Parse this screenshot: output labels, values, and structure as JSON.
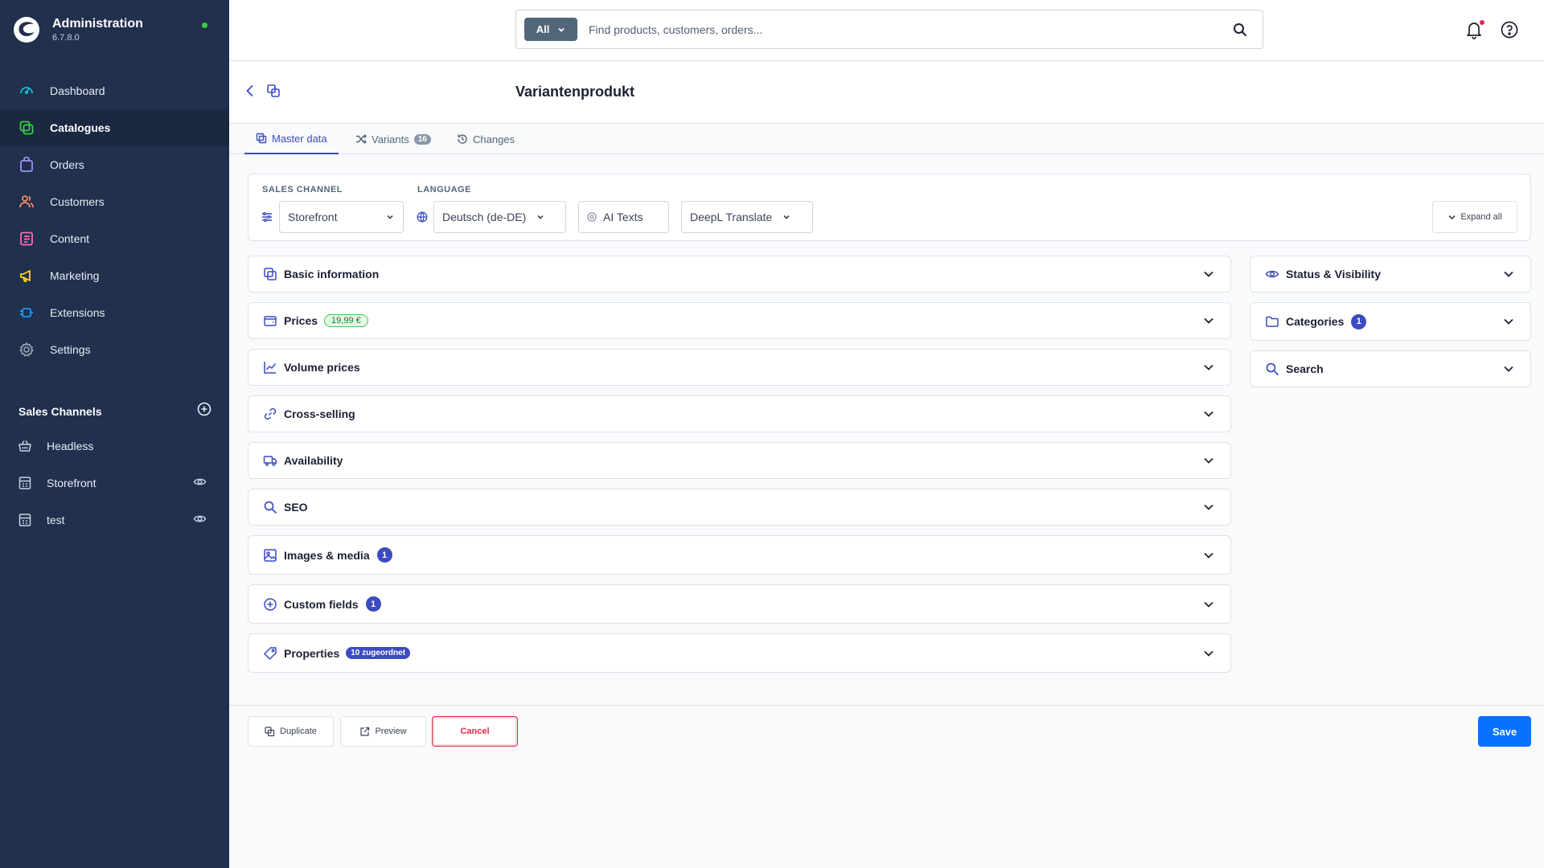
{
  "app": {
    "title": "Administration",
    "version": "6.7.8.0",
    "status_color": "#37d046"
  },
  "sidebar": {
    "items": [
      {
        "label": "Dashboard",
        "icon": "dashboard-icon",
        "color": "#18bfcc"
      },
      {
        "label": "Catalogues",
        "icon": "catalogues-icon",
        "color": "#37d046",
        "active": true
      },
      {
        "label": "Orders",
        "icon": "orders-icon",
        "color": "#a092f0"
      },
      {
        "label": "Customers",
        "icon": "customers-icon",
        "color": "#f88962"
      },
      {
        "label": "Content",
        "icon": "content-icon",
        "color": "#ff68b4"
      },
      {
        "label": "Marketing",
        "icon": "marketing-icon",
        "color": "#ffd700"
      },
      {
        "label": "Extensions",
        "icon": "extensions-icon",
        "color": "#189eff"
      },
      {
        "label": "Settings",
        "icon": "settings-icon",
        "color": "#9aa8b5"
      }
    ],
    "sales_channels": {
      "title": "Sales Channels",
      "items": [
        {
          "label": "Headless",
          "icon": "basket-icon",
          "has_eye": false
        },
        {
          "label": "Storefront",
          "icon": "storefront-icon",
          "has_eye": true
        },
        {
          "label": "test",
          "icon": "storefront-icon",
          "has_eye": true
        }
      ]
    }
  },
  "topbar": {
    "search_type": "All",
    "search_placeholder": "Find products, customers, orders..."
  },
  "page": {
    "title": "Variantenprodukt"
  },
  "tabs": [
    {
      "label": "Master data",
      "icon": "product-icon",
      "active": true
    },
    {
      "label": "Variants",
      "icon": "shuffle-icon",
      "badge": "16"
    },
    {
      "label": "Changes",
      "icon": "history-icon"
    }
  ],
  "filters": {
    "sales_channel_label": "SALES CHANNEL",
    "sales_channel_value": "Storefront",
    "language_label": "LANGUAGE",
    "language_value": "Deutsch (de-DE)",
    "ai_texts": "AI Texts",
    "deepl": "DeepL Translate",
    "expand_all": "Expand all"
  },
  "main_sections": [
    {
      "label": "Basic information",
      "icon": "product-icon"
    },
    {
      "label": "Prices",
      "icon": "wallet-icon",
      "badge_green": "19,99 €"
    },
    {
      "label": "Volume prices",
      "icon": "chart-icon"
    },
    {
      "label": "Cross-selling",
      "icon": "link-icon"
    },
    {
      "label": "Availability",
      "icon": "truck-icon"
    },
    {
      "label": "SEO",
      "icon": "search-icon"
    },
    {
      "label": "Images & media",
      "icon": "image-icon",
      "badge_num": "1"
    },
    {
      "label": "Custom fields",
      "icon": "plus-circle-icon",
      "badge_num": "1"
    },
    {
      "label": "Properties",
      "icon": "tag-icon",
      "badge_pill": "10 zugeordnet"
    }
  ],
  "side_sections": [
    {
      "label": "Status & Visibility",
      "icon": "eye-icon"
    },
    {
      "label": "Categories",
      "icon": "folder-icon",
      "badge_num": "1"
    },
    {
      "label": "Search",
      "icon": "search-icon"
    }
  ],
  "actions": {
    "duplicate": "Duplicate",
    "preview": "Preview",
    "cancel": "Cancel",
    "save": "Save"
  },
  "colors": {
    "accent": "#3c4bc2",
    "save": "#0870ff",
    "danger": "#de294c",
    "sidebar": "#20304d"
  }
}
